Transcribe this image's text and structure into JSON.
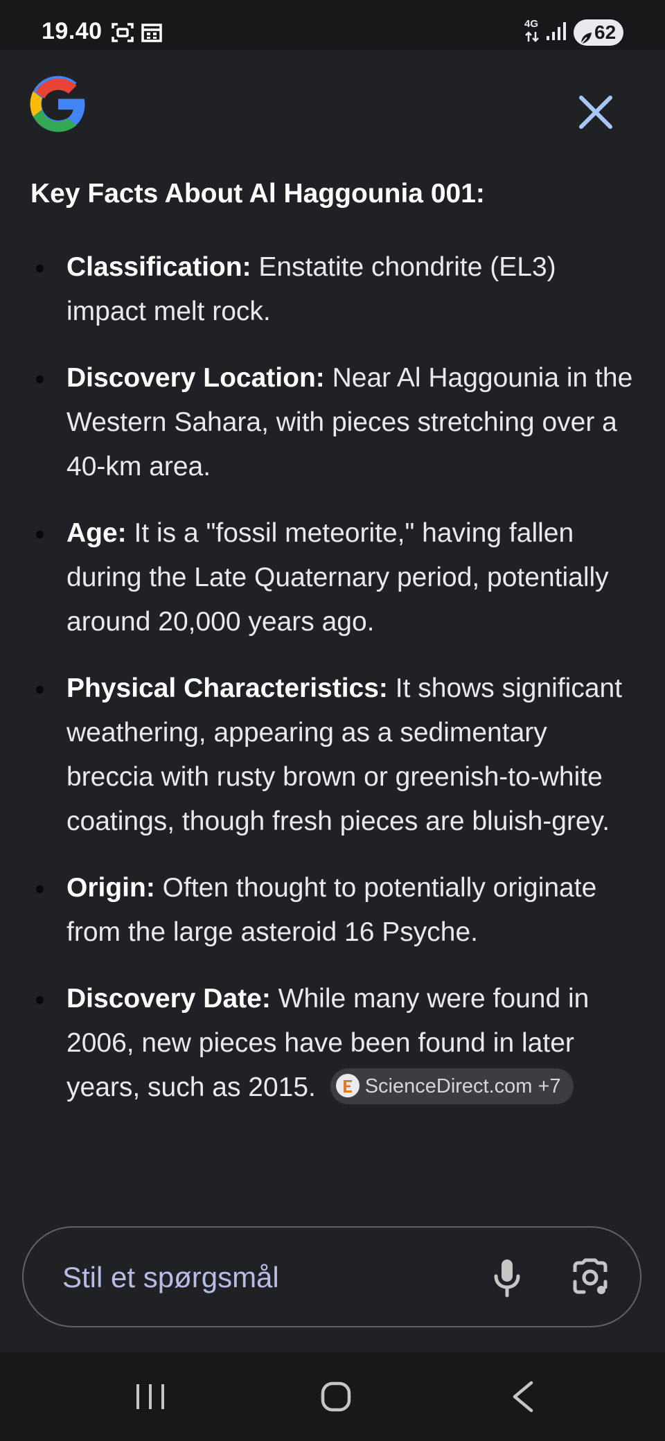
{
  "status_bar": {
    "time": "19.40",
    "network": "4G",
    "battery": "62",
    "icons": [
      "screenshot-icon",
      "calendar-icon",
      "data-arrows-icon",
      "signal-icon",
      "battery-saver-icon"
    ]
  },
  "header": {
    "logo_icon": "google-g-icon",
    "close_icon": "close-icon"
  },
  "content": {
    "heading": "Key Facts About Al Haggounia 001:",
    "facts": [
      {
        "label": "Classification:",
        "text": "Enstatite chondrite (EL3) impact melt rock."
      },
      {
        "label": "Discovery Location:",
        "text": "Near Al Haggounia in the Western Sahara, with pieces stretching over a 40-km area."
      },
      {
        "label": "Age:",
        "text": "It is a \"fossil meteorite,\" having fallen during the Late Quaternary period, potentially around 20,000 years ago."
      },
      {
        "label": "Physical Characteristics:",
        "text": "It shows significant weathering, appearing as a sedimentary breccia with rusty brown or greenish-to-white coatings, though fresh pieces are bluish-grey."
      },
      {
        "label": "Origin:",
        "text": "Often thought to potentially originate from the large asteroid 16 Psyche."
      },
      {
        "label": "Discovery Date:",
        "text": "While many were found in 2006, new pieces have been found in later years, such as 2015."
      }
    ],
    "source_chip": {
      "label": "ScienceDirect.com +7",
      "icon": "sciencedirect-logo-icon"
    }
  },
  "ask_bar": {
    "placeholder": "Stil et spørgsmål",
    "mic_icon": "microphone-icon",
    "lens_icon": "camera-lens-icon"
  },
  "nav_bar": {
    "items": [
      "recent-apps-icon",
      "home-icon",
      "back-icon"
    ]
  },
  "colors": {
    "background": "#202124",
    "status_bar": "#17181a",
    "text": "#e8eaed",
    "chip_bg": "#3c3d40",
    "placeholder": "#b9bde6",
    "close_icon": "#a8c7fa"
  }
}
